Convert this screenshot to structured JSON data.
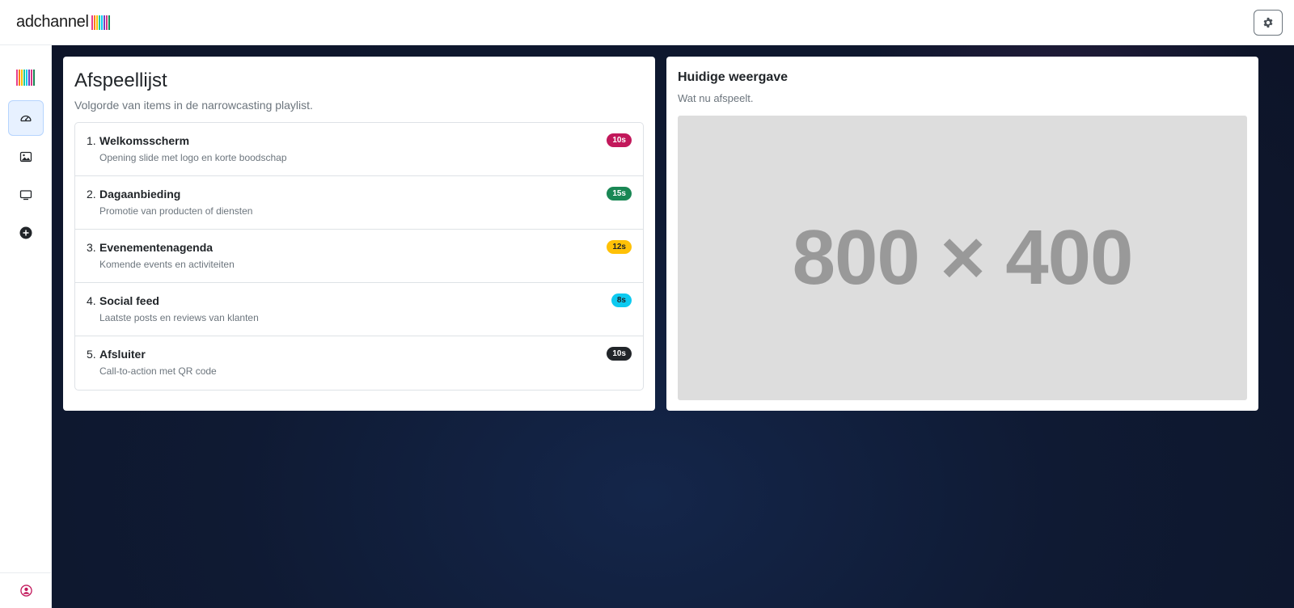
{
  "brand": {
    "name": "adchannel",
    "bar_colors": [
      "#e83e8c",
      "#fd7e14",
      "#ffc107",
      "#20c997",
      "#0dcaf0",
      "#6f42c1",
      "#d63384",
      "#198754"
    ]
  },
  "topbar": {
    "settings_icon": "gear-icon"
  },
  "sidebar": {
    "items": [
      {
        "name": "dashboard",
        "icon": "speedometer-icon",
        "active": true
      },
      {
        "name": "media",
        "icon": "image-icon",
        "active": false
      },
      {
        "name": "screens",
        "icon": "tv-icon",
        "active": false
      },
      {
        "name": "add",
        "icon": "plus-circle-icon",
        "active": false
      }
    ],
    "bottom_icon": "user-circle-icon"
  },
  "playlist": {
    "title": "Afspeellijst",
    "subtitle": "Volgorde van items in de narrowcasting playlist.",
    "items": [
      {
        "num": "1.",
        "title": "Welkomsscherm",
        "desc": "Opening slide met logo en korte boodschap",
        "duration": "10s",
        "color": "#c2185b",
        "text_color": "#ffffff"
      },
      {
        "num": "2.",
        "title": "Dagaanbieding",
        "desc": "Promotie van producten of diensten",
        "duration": "15s",
        "color": "#198754",
        "text_color": "#ffffff"
      },
      {
        "num": "3.",
        "title": "Evenementenagenda",
        "desc": "Komende events en activiteiten",
        "duration": "12s",
        "color": "#ffc107",
        "text_color": "#212529"
      },
      {
        "num": "4.",
        "title": "Social feed",
        "desc": "Laatste posts en reviews van klanten",
        "duration": "8s",
        "color": "#0dcaf0",
        "text_color": "#212529"
      },
      {
        "num": "5.",
        "title": "Afsluiter",
        "desc": "Call-to-action met QR code",
        "duration": "10s",
        "color": "#212529",
        "text_color": "#ffffff"
      }
    ]
  },
  "current": {
    "title": "Huidige weergave",
    "subtitle": "Wat nu afspeelt.",
    "placeholder_text": "800 × 400"
  }
}
